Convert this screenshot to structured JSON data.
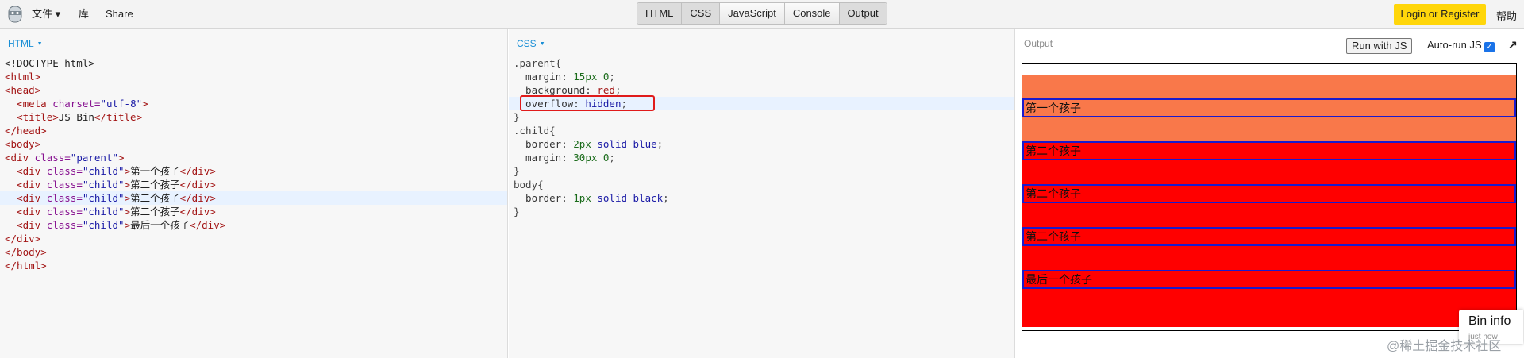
{
  "menu": {
    "file_label": "文件 ▾",
    "library_label": "库",
    "share_label": "Share"
  },
  "tabs": [
    "HTML",
    "CSS",
    "JavaScript",
    "Console",
    "Output"
  ],
  "account": {
    "login_label": "Login or Register",
    "help_label": "帮助"
  },
  "html_panel": {
    "title": "HTML",
    "lines": [
      [
        [
          "tx",
          "<!DOCTYPE html>"
        ]
      ],
      [
        [
          "tg",
          "<html>"
        ]
      ],
      [
        [
          "tg",
          "<head>"
        ]
      ],
      [
        [
          "tx",
          "  "
        ],
        [
          "tg",
          "<meta "
        ],
        [
          "at",
          "charset="
        ],
        [
          "st",
          "\"utf-8\""
        ],
        [
          "tg",
          ">"
        ]
      ],
      [
        [
          "tx",
          "  "
        ],
        [
          "tg",
          "<title>"
        ],
        [
          "tx",
          "JS Bin"
        ],
        [
          "tg",
          "</title>"
        ]
      ],
      [
        [
          "tg",
          "</head>"
        ]
      ],
      [
        [
          "tg",
          "<body>"
        ]
      ],
      [
        [
          "tg",
          "<div "
        ],
        [
          "at",
          "class="
        ],
        [
          "st",
          "\"parent\""
        ],
        [
          "tg",
          ">"
        ]
      ],
      [
        [
          "tx",
          "  "
        ],
        [
          "tg",
          "<div "
        ],
        [
          "at",
          "class="
        ],
        [
          "st",
          "\"child\""
        ],
        [
          "tg",
          ">"
        ],
        [
          "tx",
          "第一个孩子"
        ],
        [
          "tg",
          "</div>"
        ]
      ],
      [
        [
          "tx",
          "  "
        ],
        [
          "tg",
          "<div "
        ],
        [
          "at",
          "class="
        ],
        [
          "st",
          "\"child\""
        ],
        [
          "tg",
          ">"
        ],
        [
          "tx",
          "第二个孩子"
        ],
        [
          "tg",
          "</div>"
        ]
      ],
      [
        [
          "tx",
          "  "
        ],
        [
          "tg",
          "<div "
        ],
        [
          "at",
          "class="
        ],
        [
          "st",
          "\"child\""
        ],
        [
          "tg",
          ">"
        ],
        [
          "tx",
          "第二个孩子"
        ],
        [
          "tg",
          "</div>"
        ]
      ],
      [
        [
          "tx",
          "  "
        ],
        [
          "tg",
          "<div "
        ],
        [
          "at",
          "class="
        ],
        [
          "st",
          "\"child\""
        ],
        [
          "tg",
          ">"
        ],
        [
          "tx",
          "第二个孩子"
        ],
        [
          "tg",
          "</div>"
        ]
      ],
      [
        [
          "tx",
          "  "
        ],
        [
          "tg",
          "<div "
        ],
        [
          "at",
          "class="
        ],
        [
          "st",
          "\"child\""
        ],
        [
          "tg",
          ">"
        ],
        [
          "tx",
          "最后一个孩子"
        ],
        [
          "tg",
          "</div>"
        ]
      ],
      [
        [
          "tg",
          "</div>"
        ]
      ],
      [
        [
          "tg",
          "</body>"
        ]
      ],
      [
        [
          "tg",
          "</html>"
        ]
      ]
    ]
  },
  "css_panel": {
    "title": "CSS",
    "lines": [
      [
        [
          "sel",
          ".parent{"
        ]
      ],
      [
        [
          "pr",
          "  margin: "
        ],
        [
          "num",
          "15px 0"
        ],
        [
          "br",
          ";"
        ]
      ],
      [
        [
          "pr",
          "  background: "
        ],
        [
          "tg",
          "red"
        ],
        [
          "br",
          ";"
        ]
      ],
      [
        [
          "pr",
          "  overflow: "
        ],
        [
          "vl",
          "hidden"
        ],
        [
          "br",
          ";"
        ]
      ],
      [
        [
          "br",
          "}"
        ]
      ],
      [
        [
          "sel",
          ".child{"
        ]
      ],
      [
        [
          "pr",
          "  border: "
        ],
        [
          "num",
          "2px"
        ],
        [
          "vl",
          " solid blue"
        ],
        [
          "br",
          ";"
        ]
      ],
      [
        [
          "pr",
          "  margin: "
        ],
        [
          "num",
          "30px 0"
        ],
        [
          "br",
          ";"
        ]
      ],
      [
        [
          "br",
          "}"
        ]
      ],
      [
        [
          "sel",
          "body{"
        ]
      ],
      [
        [
          "pr",
          "  border: "
        ],
        [
          "num",
          "1px"
        ],
        [
          "vl",
          " solid black"
        ],
        [
          "br",
          ";"
        ]
      ],
      [
        [
          "br",
          "}"
        ]
      ]
    ]
  },
  "output_panel": {
    "title": "Output",
    "run_label": "Run with JS",
    "autorun_label": "Auto-run JS",
    "autorun_checked": true,
    "children": [
      "第一个孩子",
      "第二个孩子",
      "第二个孩子",
      "第二个孩子",
      "最后一个孩子"
    ],
    "colors": {
      "parent_bg": "#ff0000",
      "margin_area": "#f9784a",
      "child_border": "#1a1acc"
    }
  },
  "bin_info": {
    "title": "Bin info",
    "subtitle": "just now"
  },
  "watermark": "@稀土掘金技术社区",
  "colors": {
    "accent_blue": "#1a8fd6",
    "login_yellow": "#ffd60a",
    "highlight_box": "#e01b1b"
  }
}
